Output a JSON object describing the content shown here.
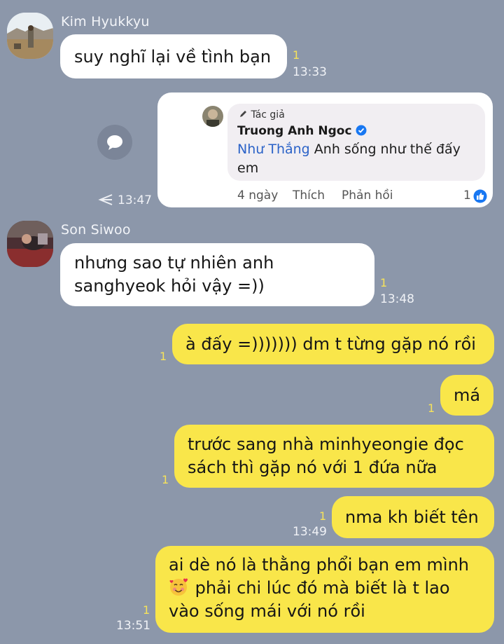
{
  "colors": {
    "background": "#8c97aa",
    "incoming_bubble": "#ffffff",
    "outgoing_bubble": "#f9e64a",
    "read_count": "#f6e35b",
    "mention": "#2c63c8",
    "like_badge": "#1877f2"
  },
  "messages": [
    {
      "id": "m1",
      "sender": "Kim Hyukkyu",
      "text": "suy nghĩ lại về tình bạn",
      "read": "1",
      "time": "13:33"
    },
    {
      "id": "m2",
      "shared_comment": {
        "tag": "Tác giả",
        "author": "Truong Anh Ngoc",
        "verified": true,
        "mention": "Như Thắng",
        "text": " Anh sống như thế đấy em",
        "age": "4 ngày",
        "like_label": "Thích",
        "reply_label": "Phản hồi",
        "like_count": "1"
      },
      "time": "13:47",
      "share_icon": "share-icon"
    },
    {
      "id": "m3",
      "sender": "Son Siwoo",
      "lines": [
        "nhưng sao tự nhiên anh",
        "sanghyeok hỏi vậy =))"
      ],
      "read": "1",
      "time": "13:48"
    },
    {
      "id": "m4",
      "text": "à đấy =))))))) dm t từng gặp nó rồi",
      "read": "1"
    },
    {
      "id": "m5",
      "text": "má",
      "read": "1"
    },
    {
      "id": "m6",
      "lines": [
        "trước sang nhà minhyeongie đọc",
        "sách thì gặp nó với 1 đứa nữa"
      ],
      "read": "1"
    },
    {
      "id": "m7",
      "text": "nma kh biết tên",
      "read": "1",
      "time": "13:49"
    },
    {
      "id": "m8",
      "lines": [
        "ai dè nó là thằng phổi bạn em mình",
        " phải chi lúc đó mà biết là t lao",
        "vào sống mái với nó rồi"
      ],
      "emoji": "smiling-face-with-hearts",
      "read": "1",
      "time": "13:51"
    }
  ]
}
